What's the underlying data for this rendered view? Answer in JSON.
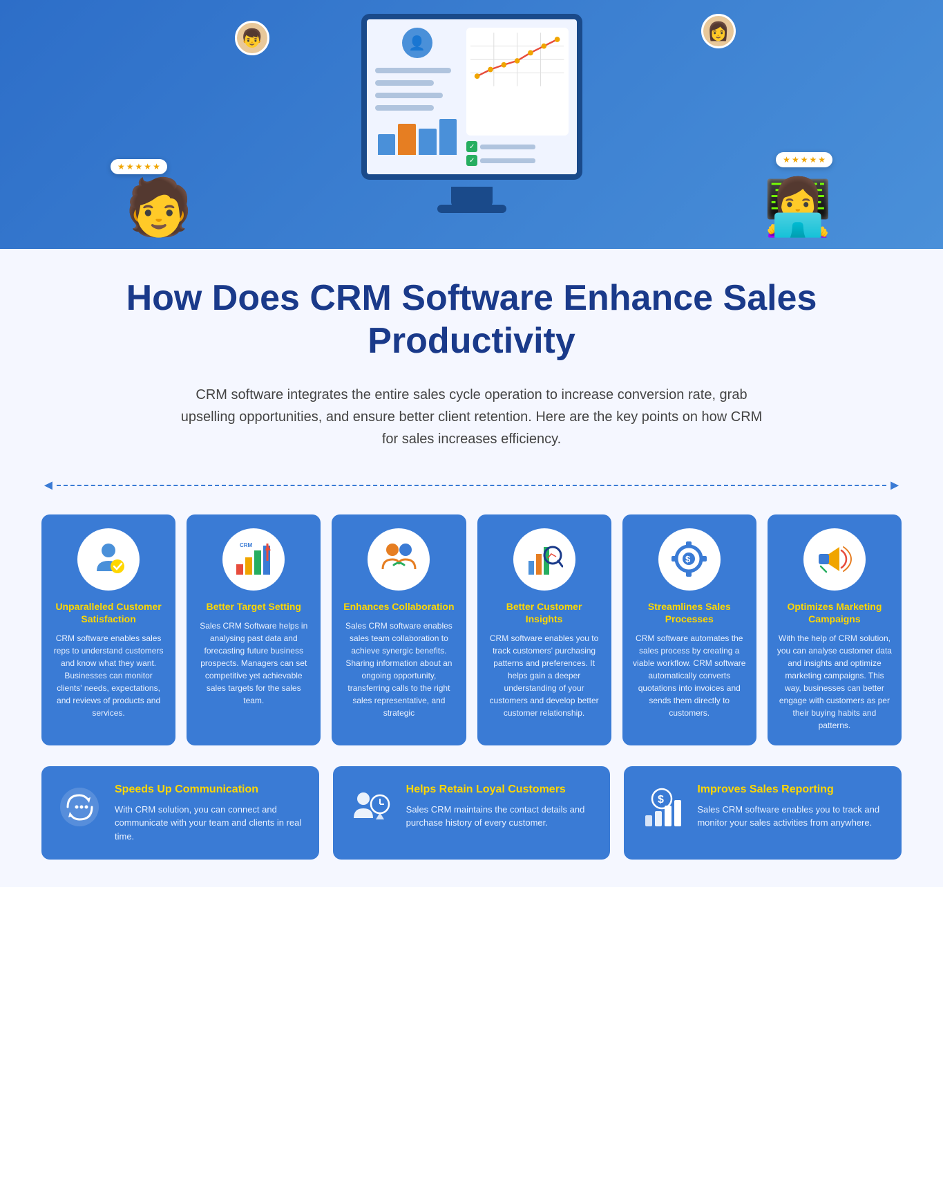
{
  "hero": {
    "bg_color": "#3a7bd5"
  },
  "page": {
    "title": "How Does CRM Software Enhance Sales Productivity",
    "subtitle": "CRM software integrates the entire sales cycle operation to increase conversion rate, grab upselling opportunities, and ensure better client retention. Here are the key points on how CRM for sales increases efficiency."
  },
  "cards": [
    {
      "icon": "🏆",
      "title": "Unparalleled Customer Satisfaction",
      "body": "CRM software enables sales reps to understand customers and know what they want. Businesses can monitor clients' needs, expectations, and reviews of products and services."
    },
    {
      "icon": "📊",
      "title": "Better Target Setting",
      "body": "Sales CRM Software helps in analysing past data and forecasting future business prospects. Managers can set competitive yet achievable sales targets for the sales team."
    },
    {
      "icon": "🤝",
      "title": "Enhances Collaboration",
      "body": "Sales CRM software enables sales team collaboration to achieve synergic benefits. Sharing information about an ongoing opportunity, transferring calls to the right sales representative, and strategic"
    },
    {
      "icon": "🔍",
      "title": "Better Customer Insights",
      "body": "CRM software enables you to track customers' purchasing patterns and preferences. It helps gain a deeper understanding of your customers and develop better customer relationship."
    },
    {
      "icon": "⚙️",
      "title": "Streamlines Sales Processes",
      "body": "CRM software automates the sales process by creating a viable workflow. CRM software automatically converts quotations into invoices and sends them directly to customers."
    },
    {
      "icon": "📣",
      "title": "Optimizes Marketing Campaigns",
      "body": "With the help of CRM solution, you can analyse customer data and insights and optimize marketing campaigns. This way, businesses can better engage with customers as per their buying habits and patterns."
    }
  ],
  "bottom_cards": [
    {
      "icon": "🔗",
      "title": "Speeds Up Communication",
      "body": "With CRM solution, you can connect and communicate with your team and clients in real time."
    },
    {
      "icon": "👥",
      "title": "Helps Retain Loyal Customers",
      "body": "Sales CRM maintains the contact details and purchase history of every customer."
    },
    {
      "icon": "💲",
      "title": "Improves Sales Reporting",
      "body": "Sales CRM software enables you to track and monitor your sales activities from anywhere."
    }
  ],
  "rating": {
    "stars": "★★★★★"
  }
}
